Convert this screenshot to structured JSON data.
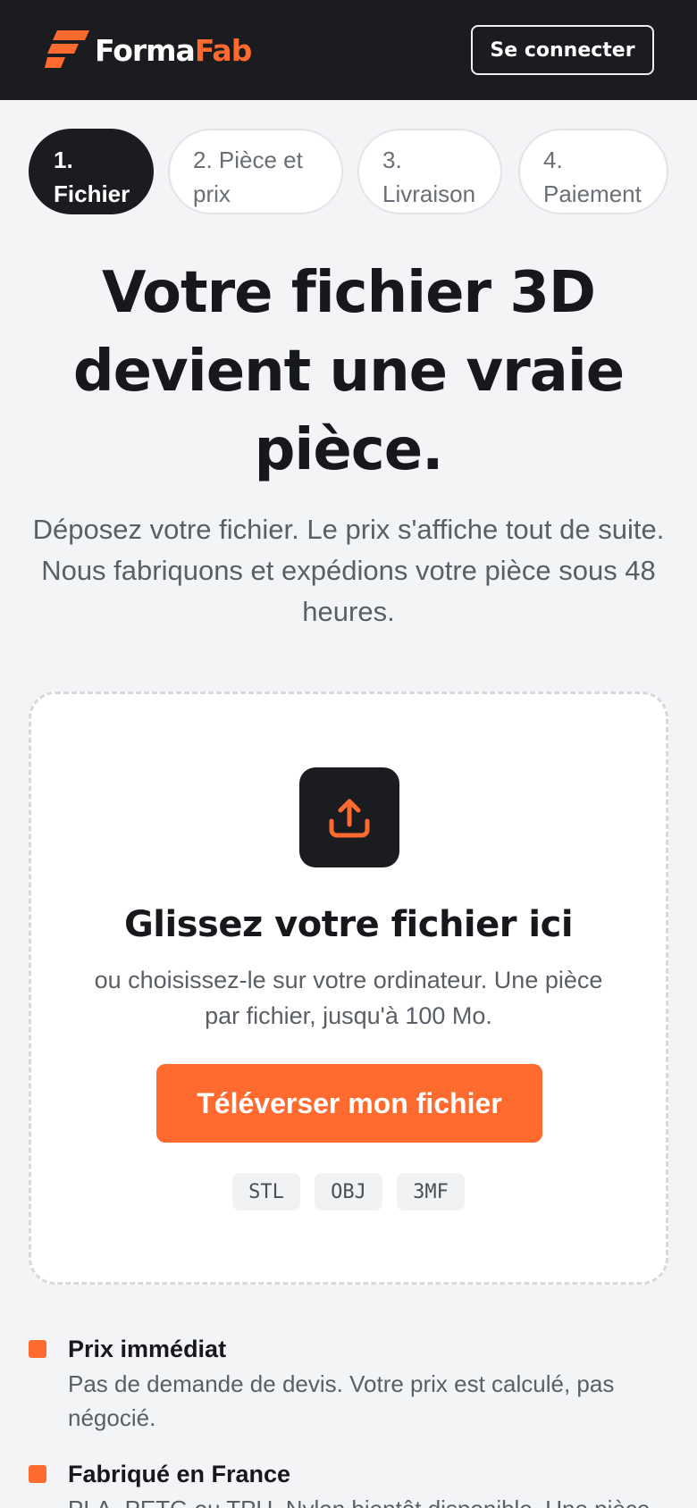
{
  "colors": {
    "accent": "#ff6a2f",
    "header_bg": "#1b1c1f",
    "page_bg": "#f3f4f6",
    "card_bg": "#ffffff"
  },
  "header": {
    "brand": {
      "part1": "Forma",
      "part2": "Fab",
      "logo_icon": "formafab-logo-icon"
    },
    "login_label": "Se connecter"
  },
  "steps": [
    {
      "number": "1.",
      "label": "Fichier",
      "active": true
    },
    {
      "number": "2. Pièce et",
      "label": "prix",
      "active": false
    },
    {
      "number": "3.",
      "label": "Livraison",
      "active": false
    },
    {
      "number": "4.",
      "label": "Paiement",
      "active": false
    }
  ],
  "hero": {
    "title": "Votre fichier 3D devient une vraie pièce.",
    "subtitle": "Déposez votre fichier. Le prix s'affiche tout de suite. Nous fabriquons et expédions votre pièce sous 48 heures."
  },
  "upload": {
    "icon": "upload-icon",
    "title": "Glissez votre fichier ici",
    "description": "ou choisissez-le sur votre ordinateur. Une pièce par fichier, jusqu'à 100 Mo.",
    "button_label": "Téléverser mon fichier",
    "formats": [
      "STL",
      "OBJ",
      "3MF"
    ]
  },
  "features": [
    {
      "title": "Prix immédiat",
      "description": "Pas de demande de devis. Votre prix est calculé, pas négocié."
    },
    {
      "title": "Fabriqué en France",
      "description": "PLA, PETG ou TPU. Nylon bientôt disponible. Une pièce"
    }
  ]
}
